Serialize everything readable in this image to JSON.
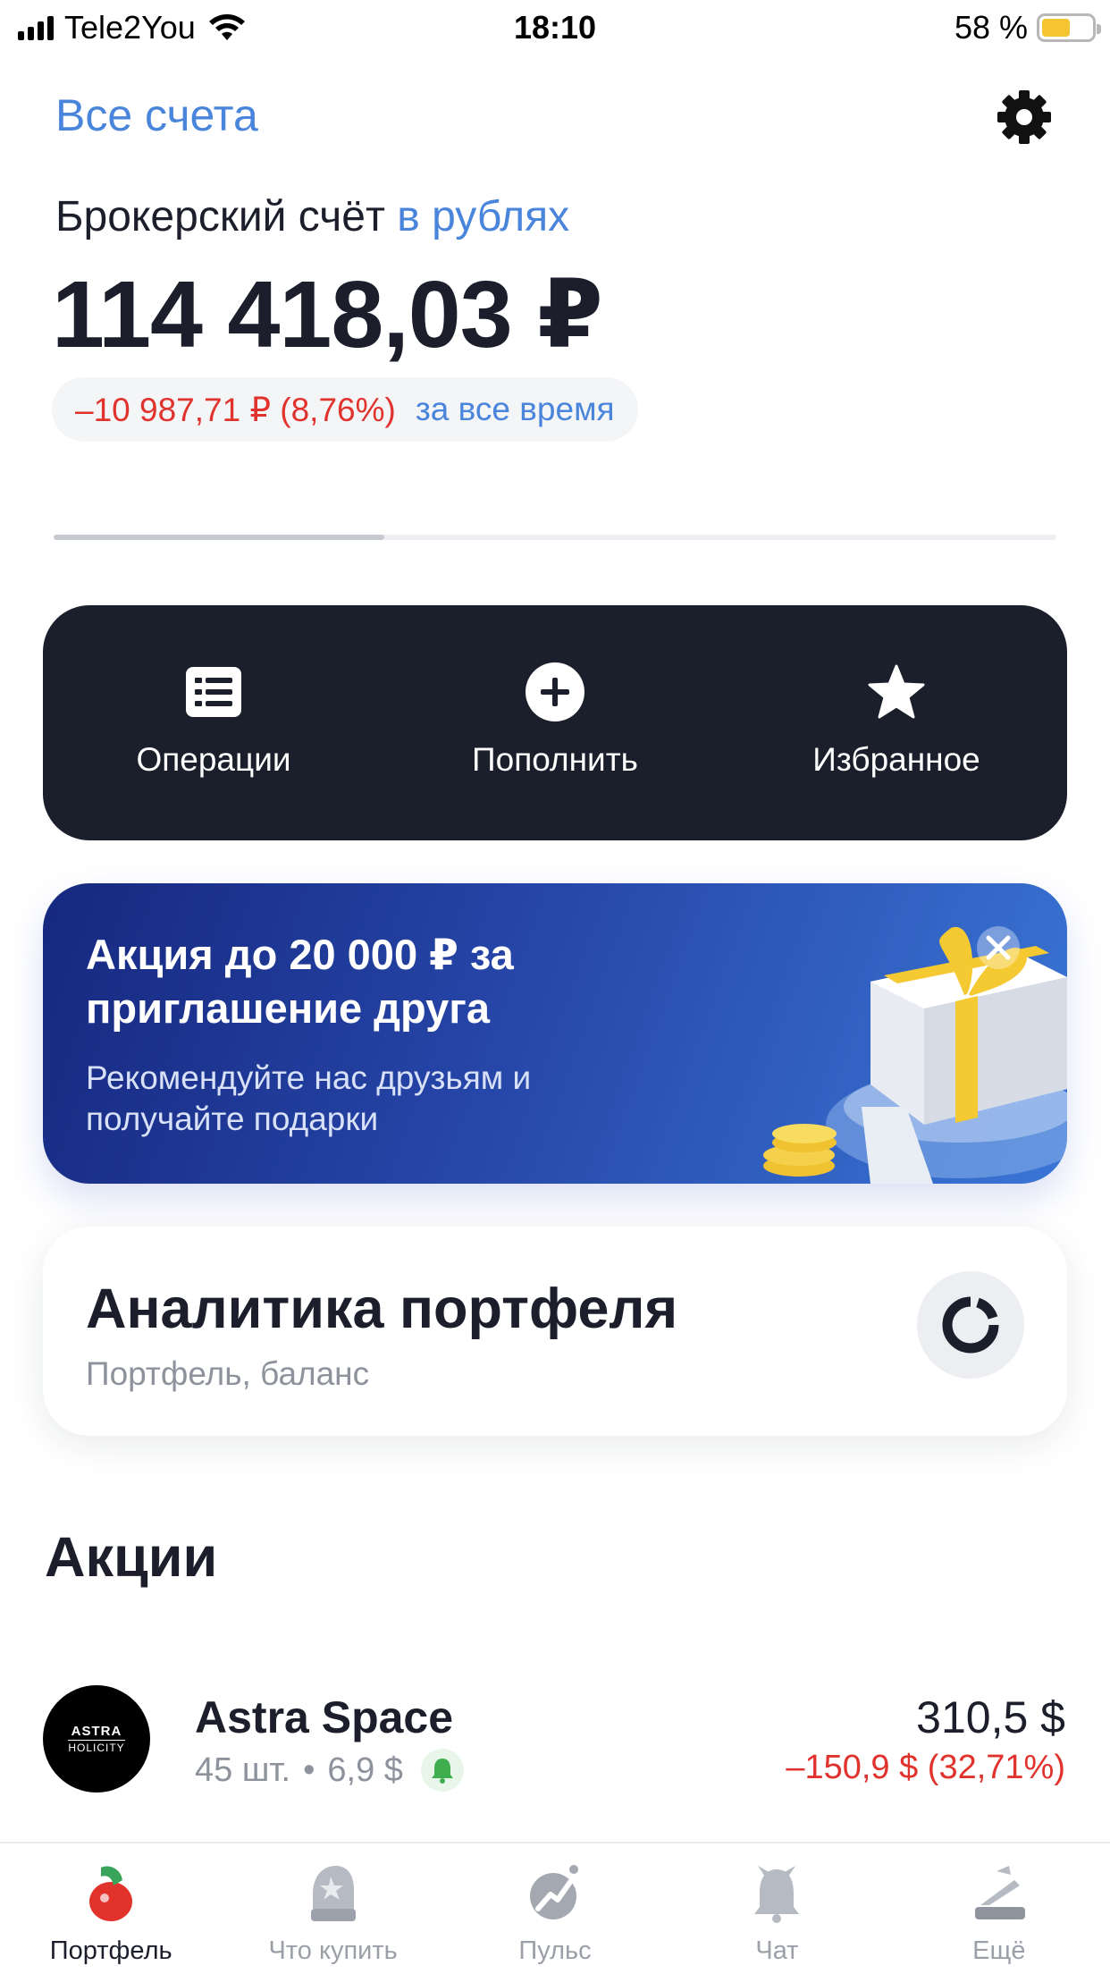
{
  "status_bar": {
    "carrier": "Tele2You",
    "time": "18:10",
    "battery": "58 %",
    "battery_level": 0.58,
    "icons": [
      "signal-icon",
      "wifi-icon",
      "battery-icon"
    ]
  },
  "header": {
    "all_accounts": "Все счета",
    "settings_icon": "gear-icon"
  },
  "account": {
    "title": "Брокерский счёт",
    "currency": "в рублях",
    "balance": "114 418,03 ₽",
    "change": "–10 987,71 ₽ (8,76%)",
    "period": "за все время",
    "slide_progress": 0.33
  },
  "actions": [
    {
      "label": "Операции",
      "icon": "list-icon"
    },
    {
      "label": "Пополнить",
      "icon": "plus-circle-icon"
    },
    {
      "label": "Избранное",
      "icon": "star-icon"
    }
  ],
  "promo": {
    "title": "Акция до 20 000 ₽ за приглашение друга",
    "subtitle": "Рекомендуйте нас друзьям и получайте подарки",
    "close_icon": "close-icon",
    "art": "gift-box-illustration"
  },
  "analytics": {
    "title": "Аналитика портфеля",
    "subtitle": "Портфель, баланс",
    "icon": "donut-chart-icon"
  },
  "stocks": {
    "section_title": "Акции",
    "items": [
      {
        "name": "Astra Space",
        "logo_line1": "ASTRA",
        "logo_line2": "HOLICITY",
        "quantity": "45 шт.",
        "separator": "•",
        "unit_price": "6,9 $",
        "alert_icon": "bell-icon",
        "total": "310,5 $",
        "change": "–150,9 $ (32,71%)"
      }
    ]
  },
  "tabbar": [
    {
      "label": "Портфель",
      "icon": "portfolio-icon",
      "active": true
    },
    {
      "label": "Что купить",
      "icon": "mitten-icon",
      "active": false
    },
    {
      "label": "Пульс",
      "icon": "pulse-icon",
      "active": false
    },
    {
      "label": "Чат",
      "icon": "bell-icon",
      "active": false
    },
    {
      "label": "Ещё",
      "icon": "more-icon",
      "active": false
    }
  ],
  "colors": {
    "accent": "#4a85dc",
    "negative": "#e0332d",
    "dark_panel": "#1b1f2c",
    "promo_gradient": [
      "#16287f",
      "#3a76d6"
    ]
  }
}
